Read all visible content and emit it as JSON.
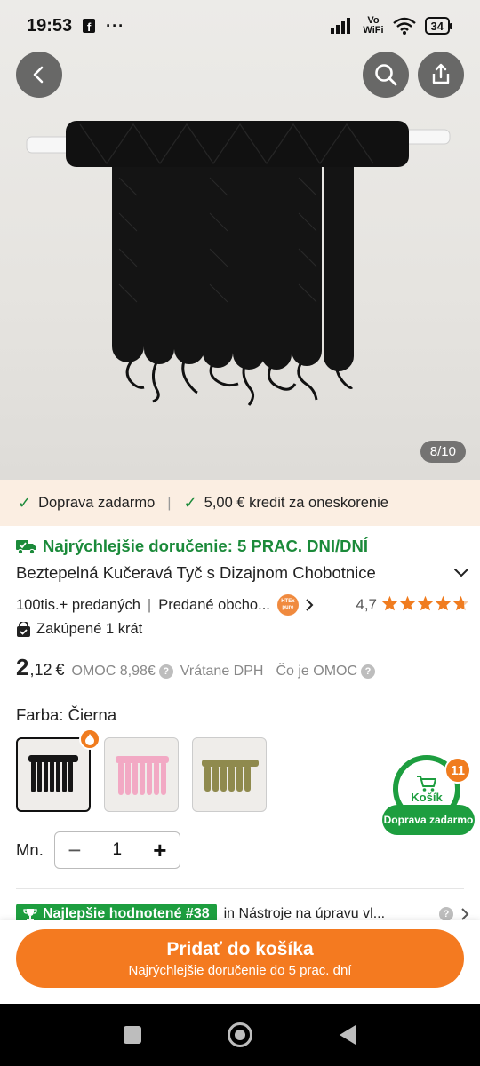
{
  "status_bar": {
    "time": "19:53",
    "fb_label": "f",
    "dots": "···",
    "vowifi_top": "Vo",
    "vowifi_bottom": "WiFi",
    "battery": "34"
  },
  "hero": {
    "counter": "8/10",
    "product_color": "#111111"
  },
  "trust_bar": {
    "item1": "Doprava zadarmo",
    "item2": "5,00 € kredit za oneskorenie",
    "separator": "|"
  },
  "product": {
    "fast_delivery": "Najrýchlejšie doručenie: 5 PRAC. DNI/DNÍ",
    "title": "Beztepelná Kučeravá Tyč s Dizajnom Chobotnice",
    "sold": "100tis.+ predaných",
    "sold_by": "Predané obcho...",
    "seller_badge": "HTEx pure",
    "separator": "|",
    "rating": "4,7",
    "stars": 4.7,
    "purchased": "Zakúpené 1 krát",
    "price_int": "2",
    "price_dec": ",12",
    "price_currency": "€",
    "omoc": "OMOC 8,98€",
    "vat": "Vrátane DPH",
    "what_omoc": "Čo je OMOC",
    "color_label": "Farba: Čierna",
    "variants": [
      {
        "name": "black",
        "color": "#161616"
      },
      {
        "name": "pink",
        "color": "#f2a9c4"
      },
      {
        "name": "olive",
        "color": "#8f8a4e"
      }
    ],
    "qty_label": "Mn.",
    "qty": "1",
    "minus": "−",
    "plus": "+"
  },
  "cart": {
    "count": "11",
    "label": "Košík",
    "pill": "Doprava zadarmo"
  },
  "ranking": {
    "badge": "Najlepšie hodnotené #38",
    "category": "in Nástroje na úpravu vl..."
  },
  "cta": {
    "main": "Pridať do košíka",
    "sub": "Najrýchlejšie doručenie do 5 prac. dní"
  },
  "colors": {
    "accent_orange": "#f47a20",
    "green": "#1d9e3f",
    "trust_bg": "#fbeee2"
  }
}
